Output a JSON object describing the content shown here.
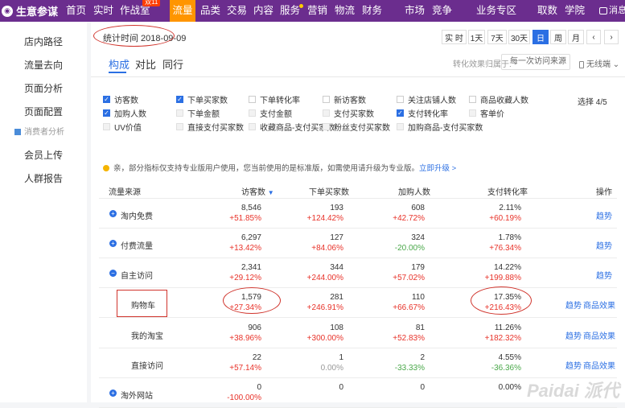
{
  "app": {
    "logo_text": "生意参谋",
    "message": "消息"
  },
  "nav": [
    {
      "label": "首页"
    },
    {
      "label": "实时"
    },
    {
      "label": "作战室",
      "badge": "双11"
    },
    {
      "label": "流量",
      "active": true
    },
    {
      "label": "品类"
    },
    {
      "label": "交易"
    },
    {
      "label": "内容"
    },
    {
      "label": "服务",
      "dot": true
    },
    {
      "label": "营销"
    },
    {
      "label": "物流"
    },
    {
      "label": "财务"
    },
    {
      "label": "市场"
    },
    {
      "label": "竞争"
    },
    {
      "label": "业务专区"
    },
    {
      "label": "取数"
    },
    {
      "label": "学院"
    }
  ],
  "sidebar": {
    "items": [
      "店内路径",
      "流量去向",
      "页面分析",
      "页面配置"
    ],
    "section": "消费者分析",
    "items2": [
      "会员上传",
      "人群报告"
    ]
  },
  "stats": {
    "date_label": "统计时间 2018-09-09"
  },
  "time_buttons": [
    "实 时",
    "1天",
    "7天",
    "30天",
    "日",
    "周",
    "月",
    "‹",
    "›"
  ],
  "tabs": [
    "构成",
    "对比",
    "同行"
  ],
  "conversion": {
    "label": "转化效果归属于:",
    "select": "每一次访问来源",
    "device": "无线端"
  },
  "checkboxes": [
    {
      "label": "访客数",
      "checked": true
    },
    {
      "label": "下单买家数",
      "checked": true
    },
    {
      "label": "下单转化率",
      "checked": false
    },
    {
      "label": "新访客数",
      "checked": false
    },
    {
      "label": "关注店铺人数",
      "checked": false
    },
    {
      "label": "商品收藏人数",
      "checked": false
    },
    {
      "label": "加购人数",
      "checked": true
    },
    {
      "label": "下单金额",
      "checked": false,
      "disabled": true
    },
    {
      "label": "支付金额",
      "checked": false,
      "disabled": true
    },
    {
      "label": "支付买家数",
      "checked": false,
      "disabled": true
    },
    {
      "label": "支付转化率",
      "checked": true
    },
    {
      "label": "客单价",
      "checked": false,
      "disabled": true
    },
    {
      "label": "UV价值",
      "checked": false,
      "disabled": true
    },
    {
      "label": "直接支付买家数",
      "checked": false,
      "disabled": true
    },
    {
      "label": "收藏商品-支付买家数",
      "checked": false,
      "disabled": true
    },
    {
      "label": "粉丝支付买家数",
      "checked": false,
      "disabled": true
    },
    {
      "label": "加购商品-支付买家数",
      "checked": false,
      "disabled": true
    }
  ],
  "select_count": "选择 4/5",
  "notice": {
    "text": "亲，部分指标仅支持专业版用户使用，您当前使用的是标准版，如需使用请升级为专业版。",
    "link": "立即升级 >"
  },
  "table": {
    "headers": [
      "流量来源",
      "访客数",
      "下单买家数",
      "加购人数",
      "支付转化率",
      "操作"
    ],
    "sort_icon": "▼",
    "rows": [
      {
        "name": "淘内免费",
        "expand": "+",
        "v": [
          "8,546",
          "193",
          "608",
          "2.11%"
        ],
        "d": [
          "+51.85%",
          "+124.42%",
          "+42.72%",
          "+60.19%"
        ],
        "actions": [
          "趋势"
        ]
      },
      {
        "name": "付费流量",
        "expand": "+",
        "v": [
          "6,297",
          "127",
          "324",
          "1.78%"
        ],
        "d": [
          "+13.42%",
          "+84.06%",
          "-20.00%",
          "+76.34%"
        ],
        "actions": [
          "趋势"
        ]
      },
      {
        "name": "自主访问",
        "expand": "−",
        "v": [
          "2,341",
          "344",
          "179",
          "14.22%"
        ],
        "d": [
          "+29.12%",
          "+244.00%",
          "+57.02%",
          "+199.88%"
        ],
        "actions": [
          "趋势"
        ]
      },
      {
        "name": "购物车",
        "v": [
          "1,579",
          "281",
          "110",
          "17.35%"
        ],
        "d": [
          "+27.34%",
          "+246.91%",
          "+66.67%",
          "+216.43%"
        ],
        "actions": [
          "趋势",
          "商品效果"
        ]
      },
      {
        "name": "我的淘宝",
        "v": [
          "906",
          "108",
          "81",
          "11.26%"
        ],
        "d": [
          "+38.96%",
          "+300.00%",
          "+52.83%",
          "+182.32%"
        ],
        "actions": [
          "趋势",
          "商品效果"
        ]
      },
      {
        "name": "直接访问",
        "v": [
          "22",
          "1",
          "2",
          "4.55%"
        ],
        "d": [
          "+57.14%",
          "0.00%",
          "-33.33%",
          "-36.36%"
        ],
        "actions": [
          "趋势",
          "商品效果"
        ]
      },
      {
        "name": "淘外网站",
        "expand": "+",
        "v": [
          "0",
          "0",
          "0",
          "0.00%"
        ],
        "d": [
          "-100.00%",
          "",
          "",
          ""
        ],
        "actions": []
      }
    ]
  },
  "watermark": "Paidai 派代"
}
